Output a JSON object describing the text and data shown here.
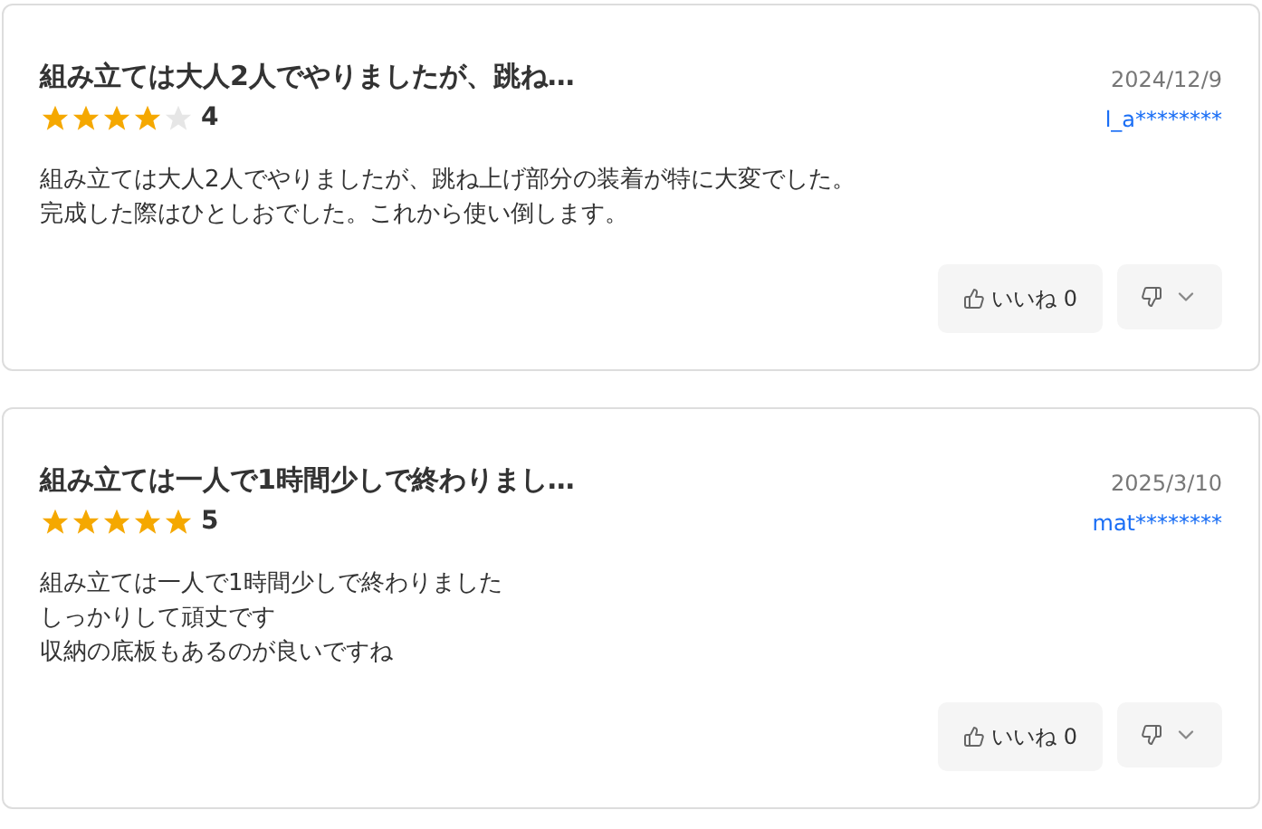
{
  "reviews": [
    {
      "title": "組み立ては大人2人でやりましたが、跳ね…",
      "date": "2024/12/9",
      "stars": 4,
      "rating": "4",
      "user": "l_a********",
      "body": [
        "組み立ては大人2人でやりましたが、跳ね上げ部分の装着が特に大変でした。",
        "完成した際はひとしおでした。これから使い倒します。"
      ],
      "like_label": "いいね 0"
    },
    {
      "title": "組み立ては一人で1時間少しで終わりまし…",
      "date": "2025/3/10",
      "stars": 5,
      "rating": "5",
      "user": "mat********",
      "body": [
        "組み立ては一人で1時間少しで終わりました",
        "しっかりして頑丈です",
        "収納の底板もあるのが良いですね"
      ],
      "like_label": "いいね 0"
    }
  ]
}
